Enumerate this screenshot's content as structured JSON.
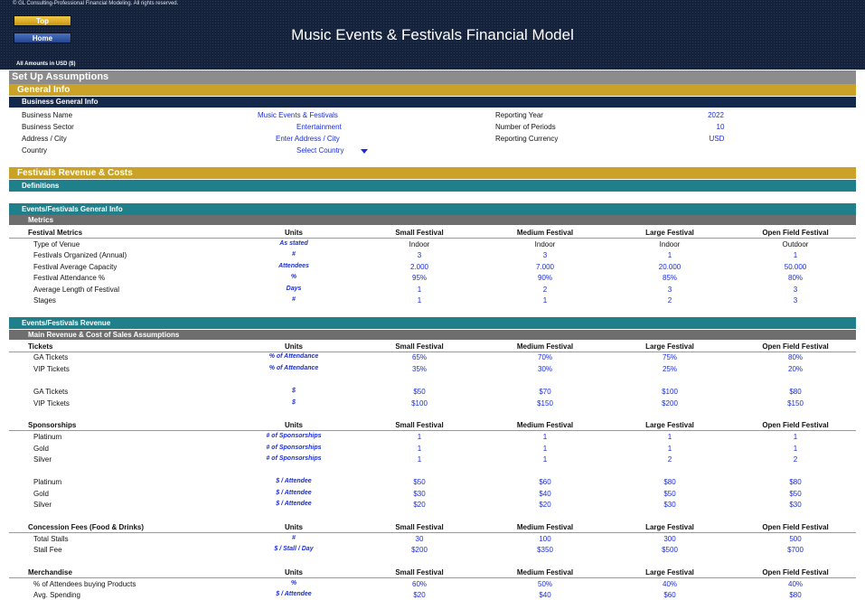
{
  "header": {
    "copyright": "© GL Consulting-Professional Financial Modeling. All rights reserved.",
    "top_button": "Top",
    "home_button": "Home",
    "title": "Music Events & Festivals Financial Model",
    "amounts_note": "All Amounts in  USD ($)"
  },
  "sections": {
    "setup": "Set Up Assumptions",
    "general_info": "General Info",
    "business_general_info": "Business General Info",
    "festivals_revenue_costs": "Festivals Revenue & Costs",
    "definitions": "Definitions",
    "events_general_info": "Events/Festivals General Info",
    "metrics": "Metrics",
    "events_revenue": "Events/Festivals Revenue",
    "main_revenue": "Main Revenue & Cost of Sales Assumptions"
  },
  "business": {
    "name_label": "Business Name",
    "name_value": "Music Events & Festivals",
    "sector_label": "Business Sector",
    "sector_value": "Entertainment",
    "address_label": "Address / City",
    "address_value": "Enter Address / City",
    "country_label": "Country",
    "country_value": "Select Country",
    "year_label": "Reporting Year",
    "year_value": "2022",
    "periods_label": "Number of Periods",
    "periods_value": "10",
    "currency_label": "Reporting Currency",
    "currency_value": "USD"
  },
  "columns": [
    "Small Festival",
    "Medium Festival",
    "Large Festival",
    "Open Field Festival"
  ],
  "units_header": "Units",
  "metrics": {
    "title": "Festival Metrics",
    "rows": [
      {
        "label": "Type of Venue",
        "unit": "As stated",
        "values": [
          "Indoor",
          "Indoor",
          "Indoor",
          "Outdoor"
        ],
        "black": true
      },
      {
        "label": "Festivals Organized (Annual)",
        "unit": "#",
        "values": [
          "3",
          "3",
          "1",
          "1"
        ]
      },
      {
        "label": "Festival Average Capacity",
        "unit": "Attendees",
        "values": [
          "2.000",
          "7.000",
          "20.000",
          "50.000"
        ]
      },
      {
        "label": "Festival Attendance %",
        "unit": "%",
        "values": [
          "95%",
          "90%",
          "85%",
          "80%"
        ]
      },
      {
        "label": "Average Length of Festival",
        "unit": "Days",
        "values": [
          "1",
          "2",
          "3",
          "3"
        ]
      },
      {
        "label": "Stages",
        "unit": "#",
        "values": [
          "1",
          "1",
          "2",
          "3"
        ]
      }
    ]
  },
  "tickets": {
    "title": "Tickets",
    "rows": [
      {
        "label": "GA Tickets",
        "unit": "% of Attendance",
        "values": [
          "65%",
          "70%",
          "75%",
          "80%"
        ]
      },
      {
        "label": "VIP Tickets",
        "unit": "% of Attendance",
        "values": [
          "35%",
          "30%",
          "25%",
          "20%"
        ]
      },
      {
        "label": "GA Tickets",
        "unit": "$",
        "values": [
          "$50",
          "$70",
          "$100",
          "$80"
        ]
      },
      {
        "label": "VIP Tickets",
        "unit": "$",
        "values": [
          "$100",
          "$150",
          "$200",
          "$150"
        ]
      }
    ]
  },
  "sponsorships": {
    "title": "Sponsorships",
    "rows": [
      {
        "label": "Platinum",
        "unit": "# of Sponsorships",
        "values": [
          "1",
          "1",
          "1",
          "1"
        ]
      },
      {
        "label": "Gold",
        "unit": "# of Sponsorships",
        "values": [
          "1",
          "1",
          "1",
          "1"
        ]
      },
      {
        "label": "Silver",
        "unit": "# of Sponsorships",
        "values": [
          "1",
          "1",
          "2",
          "2"
        ]
      },
      {
        "label": "Platinum",
        "unit": "$ / Attendee",
        "values": [
          "$50",
          "$60",
          "$80",
          "$80"
        ]
      },
      {
        "label": "Gold",
        "unit": "$ / Attendee",
        "values": [
          "$30",
          "$40",
          "$50",
          "$50"
        ]
      },
      {
        "label": "Silver",
        "unit": "$ / Attendee",
        "values": [
          "$20",
          "$20",
          "$30",
          "$30"
        ]
      }
    ]
  },
  "concession": {
    "title": "Concession Fees (Food & Drinks)",
    "rows": [
      {
        "label": "Total Stalls",
        "unit": "#",
        "values": [
          "30",
          "100",
          "300",
          "500"
        ]
      },
      {
        "label": "Stall Fee",
        "unit": "$ / Stall / Day",
        "values": [
          "$200",
          "$350",
          "$500",
          "$700"
        ]
      }
    ]
  },
  "merchandise": {
    "title": "Merchandise",
    "rows": [
      {
        "label": "% of Attendees buying Products",
        "unit": "%",
        "values": [
          "60%",
          "50%",
          "40%",
          "40%"
        ]
      },
      {
        "label": "Avg. Spending",
        "unit": "$ / Attendee",
        "values": [
          "$20",
          "$40",
          "$60",
          "$80"
        ]
      }
    ]
  }
}
